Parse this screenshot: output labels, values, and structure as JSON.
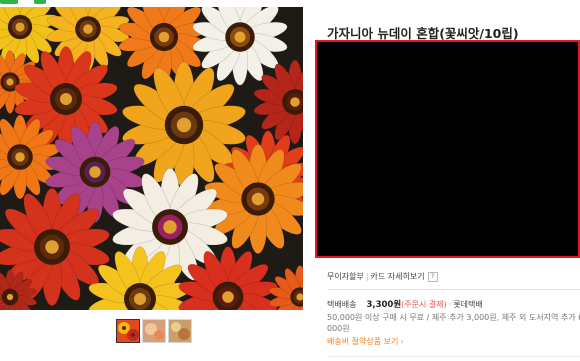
{
  "product": {
    "title": "가자니아 뉴데이 혼합(꽃씨앗/10립)"
  },
  "payment": {
    "no_interest": "무이자할부",
    "card_benefit": "카드 자세히보기",
    "help_icon": "?"
  },
  "shipping": {
    "label": "택배배송",
    "price": "3,300원",
    "pay_note": "(주문시 결제)",
    "carrier": "롯데택배",
    "condition_line1": "50,000원 이상 구매 시 무료 / 제주 추가 3,000원, 제주 외 도서지역 추가 6,",
    "condition_line2": "000원",
    "fee_link": "배송비 절약상품 보기",
    "chevron": "›"
  },
  "colors": {
    "promo_border": "#e21b23",
    "accent_orange": "#f08023",
    "price_note_red": "#e8524a"
  },
  "icons": {
    "help": "help-icon",
    "chevron": "chevron-right-icon"
  }
}
